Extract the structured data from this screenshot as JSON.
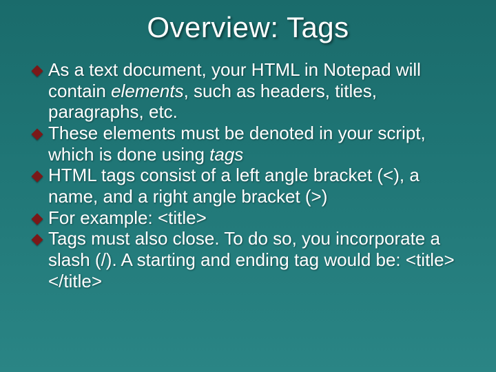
{
  "slide": {
    "title": "Overview: Tags",
    "bullets": [
      {
        "html": "As a text document, your HTML in Notepad will contain <em>elements</em>, such as headers, titles, paragraphs, etc."
      },
      {
        "html": "These elements must be denoted in your script, which is done using <em>tags</em>"
      },
      {
        "html": "HTML tags consist of a left angle bracket (&lt;), a name, and a right angle bracket (&gt;)"
      },
      {
        "html": "For example: &lt;title&gt;"
      },
      {
        "html": "Tags must also close.  To do so, you incorporate a slash (/).  A starting and ending tag would be:  &lt;title&gt; &lt;/title&gt;"
      }
    ]
  }
}
